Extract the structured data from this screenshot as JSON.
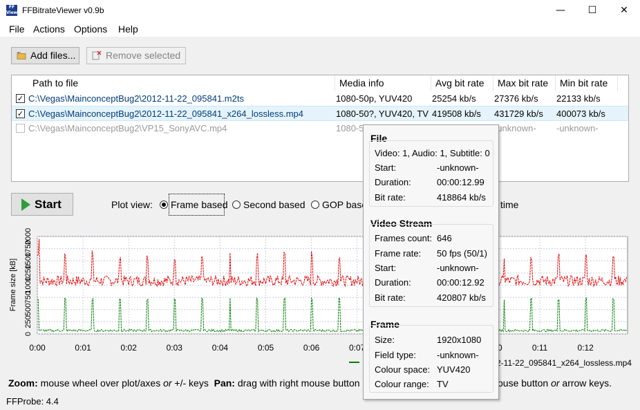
{
  "window": {
    "title": "FFBitrateViewer v0.9b",
    "icon_text": "FF View"
  },
  "menu": {
    "items": [
      "File",
      "Actions",
      "Options",
      "Help"
    ]
  },
  "toolbar": {
    "add_files": "Add files...",
    "remove_selected": "Remove selected"
  },
  "file_list": {
    "columns": [
      "Path to file",
      "Media info",
      "Avg bit rate",
      "Max bit rate",
      "Min bit rate"
    ],
    "rows": [
      {
        "checked": true,
        "path": "C:\\Vegas\\MainconceptBug2\\2012-11-22_095841.m2ts",
        "media_info": "1080-50p, YUV420",
        "avg": "25254 kb/s",
        "max": "27376 kb/s",
        "min": "22133 kb/s"
      },
      {
        "checked": true,
        "path": "C:\\Vegas\\MainconceptBug2\\2012-11-22_095841_x264_lossless.mp4",
        "media_info": "1080-50?, YUV420, TV",
        "avg": "419508 kb/s",
        "max": "431729 kb/s",
        "min": "400073 kb/s"
      },
      {
        "checked": false,
        "path": "C:\\Vegas\\MainconceptBug2\\VP15_SonyAVC.mp4",
        "media_info": "1080-5",
        "avg": "",
        "max": "-unknown-",
        "min": "-unknown-"
      }
    ]
  },
  "controls": {
    "start": "Start",
    "plot_view_label": "Plot view:",
    "plot_view_options": [
      "Frame based",
      "Second based",
      "GOP base"
    ],
    "plot_view_selected": 0,
    "hidden_option_tail": "time"
  },
  "chart_data": {
    "type": "line",
    "ylabel": "Frame size [kB]",
    "ylim": [
      0,
      2000
    ],
    "yticks": [
      "0",
      "250",
      "500",
      "750",
      "1000",
      "1250",
      "1500",
      "1750",
      "2000"
    ],
    "xlim": [
      0,
      12.92
    ],
    "xticks": [
      "0:00",
      "0:01",
      "0:02",
      "0:03",
      "0:04",
      "0:05",
      "0:06",
      "0:07",
      "0:08",
      "0:09",
      "0:10",
      "0:11",
      "0:12"
    ],
    "series": [
      {
        "color": "#e00000",
        "base": 1090,
        "noise": 110,
        "spike_every": 0.6,
        "spike": 520
      },
      {
        "color": "#008000",
        "base": 70,
        "noise": 25,
        "spike_every": 0.6,
        "spike": 650
      }
    ],
    "legend_visible_text": "2-11-22_095841_x264_lossless.mp4"
  },
  "help": {
    "zoom_label": "Zoom:",
    "zoom_text": " mouse wheel over plot/axes ",
    "or1": "or",
    "zoom_text2": " +/- keys",
    "pan_label": "Pan:",
    "pan_text": " drag with right mouse button",
    "tail": "ouse button ",
    "or2": "or",
    "tail2": " arrow keys."
  },
  "status": {
    "text": "FFProbe: 4.4"
  },
  "tooltip": {
    "file": {
      "title": "File",
      "streams": "Video: 1, Audio: 1, Subtitle: 0",
      "rows": [
        [
          "Start:",
          "-unknown-"
        ],
        [
          "Duration:",
          "00:00:12.99"
        ],
        [
          "Bit rate:",
          "418864 kb/s"
        ]
      ]
    },
    "video": {
      "title": "Video Stream",
      "rows": [
        [
          "Frames count:",
          "646"
        ],
        [
          "Frame rate:",
          "50 fps (50/1)"
        ],
        [
          "Start:",
          "-unknown-"
        ],
        [
          "Duration:",
          "00:00:12.92"
        ],
        [
          "Bit rate:",
          "420807 kb/s"
        ]
      ]
    },
    "frame": {
      "title": "Frame",
      "rows": [
        [
          "Size:",
          "1920x1080"
        ],
        [
          "Field type:",
          "-unknown-"
        ],
        [
          "Colour space:",
          "YUV420"
        ],
        [
          "Colour range:",
          "TV"
        ]
      ]
    }
  }
}
